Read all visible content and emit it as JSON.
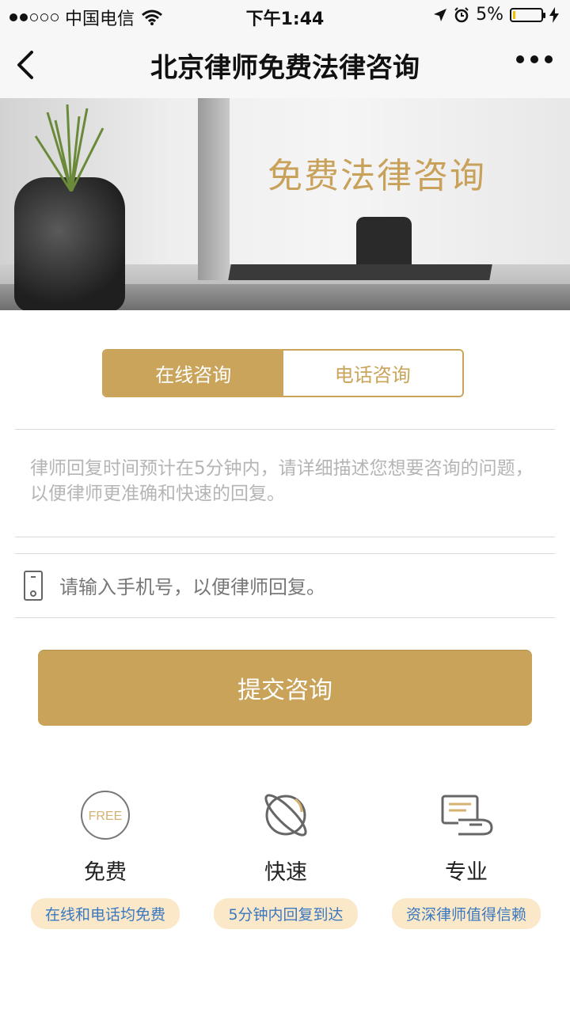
{
  "status_bar": {
    "carrier": "中国电信",
    "time": "下午1:44",
    "battery": "5%",
    "battery_level": 0.05
  },
  "nav": {
    "title": "北京律师免费法律咨询"
  },
  "banner": {
    "title": "免费法律咨询"
  },
  "tabs": [
    {
      "label": "在线咨询",
      "active": true
    },
    {
      "label": "电话咨询",
      "active": false
    }
  ],
  "form": {
    "question_placeholder": "律师回复时间预计在5分钟内，请详细描述您想要咨询的问题，以便律师更准确和快速的回复。",
    "phone_placeholder": "请输入手机号，以便律师回复。",
    "submit_label": "提交咨询"
  },
  "features": [
    {
      "icon_text": "FREE",
      "name": "免费",
      "badge": "在线和电话均免费"
    },
    {
      "name": "快速",
      "badge": "5分钟内回复到达"
    },
    {
      "name": "专业",
      "badge": "资深律师值得信赖"
    }
  ],
  "colors": {
    "accent": "#c9a45a",
    "badge_bg": "#fbe8c8",
    "badge_text": "#3a78c0"
  }
}
